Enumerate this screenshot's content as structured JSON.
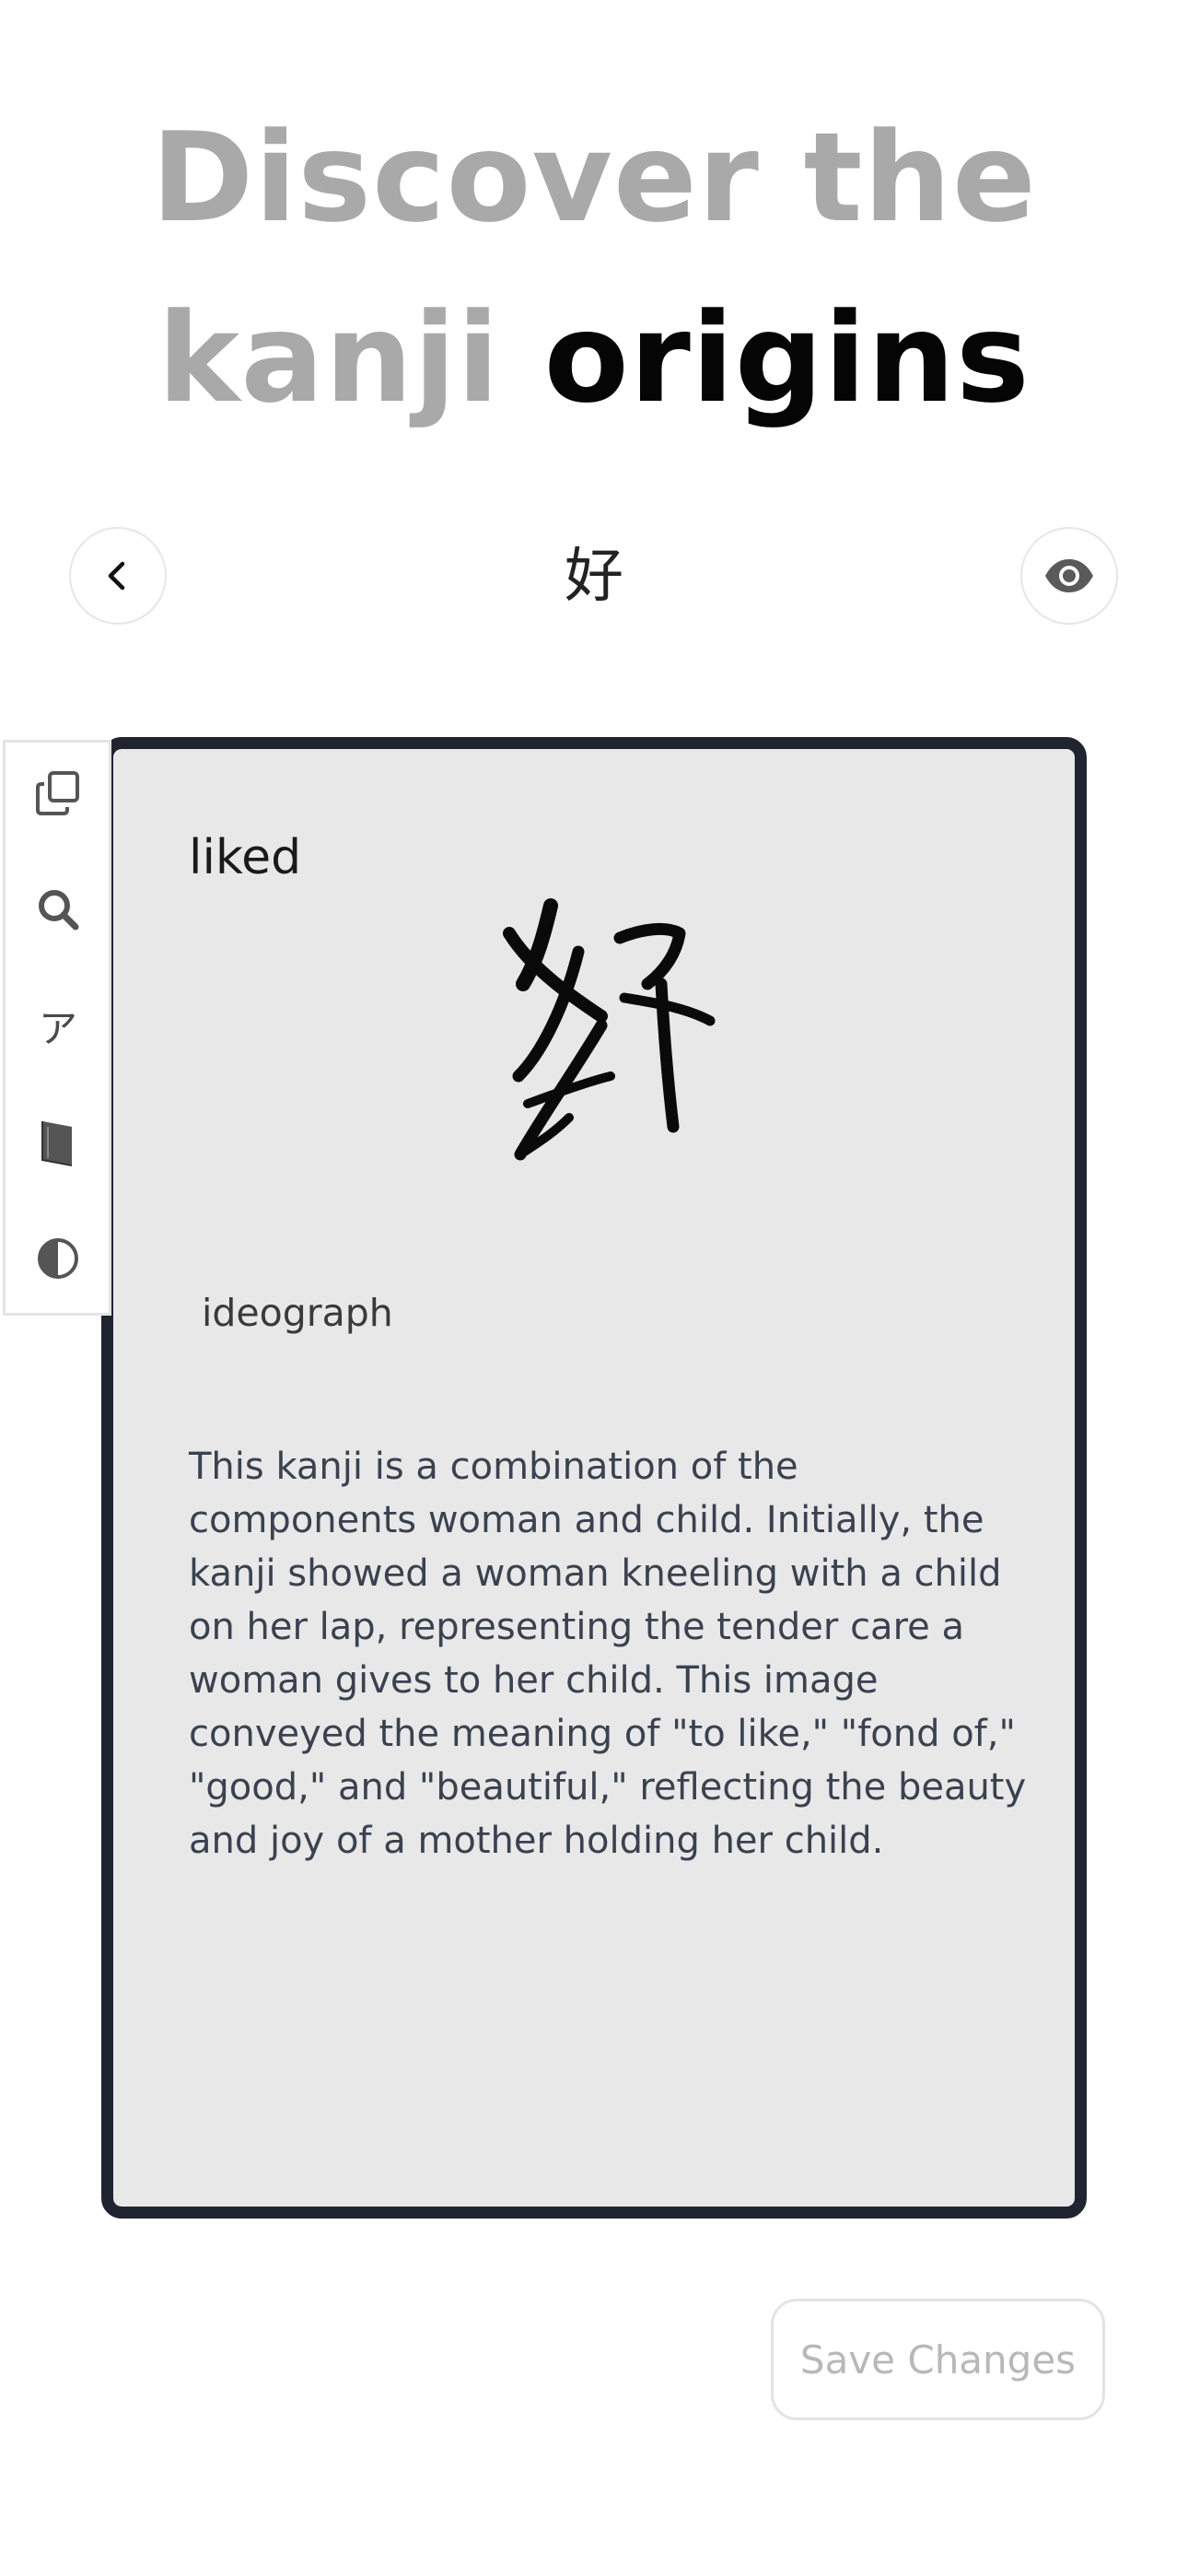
{
  "headline": {
    "line1": "Discover the",
    "line2_gray": "kanji",
    "line2_dark": "origins"
  },
  "nav": {
    "kanji": "好",
    "back_icon": "chevron-left-icon",
    "view_icon": "eye-icon"
  },
  "card": {
    "meaning": "liked",
    "type": "ideograph",
    "description": "This kanji is a combination of the components woman and child. Initially, the kanji showed a woman kneeling with a child on her lap, representing the tender care a woman gives to her child. This image conveyed the meaning of \"to like,\" \"fond of,\" \"good,\" and \"beautiful,\" reflecting the beauty and joy of a mother holding her child."
  },
  "toolbar": {
    "items": [
      {
        "icon": "copy-icon"
      },
      {
        "icon": "search-icon"
      },
      {
        "icon": "katakana-icon",
        "glyph": "ア"
      },
      {
        "icon": "book-icon"
      },
      {
        "icon": "contrast-icon"
      }
    ]
  },
  "actions": {
    "save_label": "Save Changes"
  },
  "colors": {
    "headline_gray": "#a9a9a9",
    "headline_dark": "#050505",
    "card_border": "#1f2430",
    "card_background": "#e8e8e8",
    "save_text": "#b8b8b8"
  }
}
